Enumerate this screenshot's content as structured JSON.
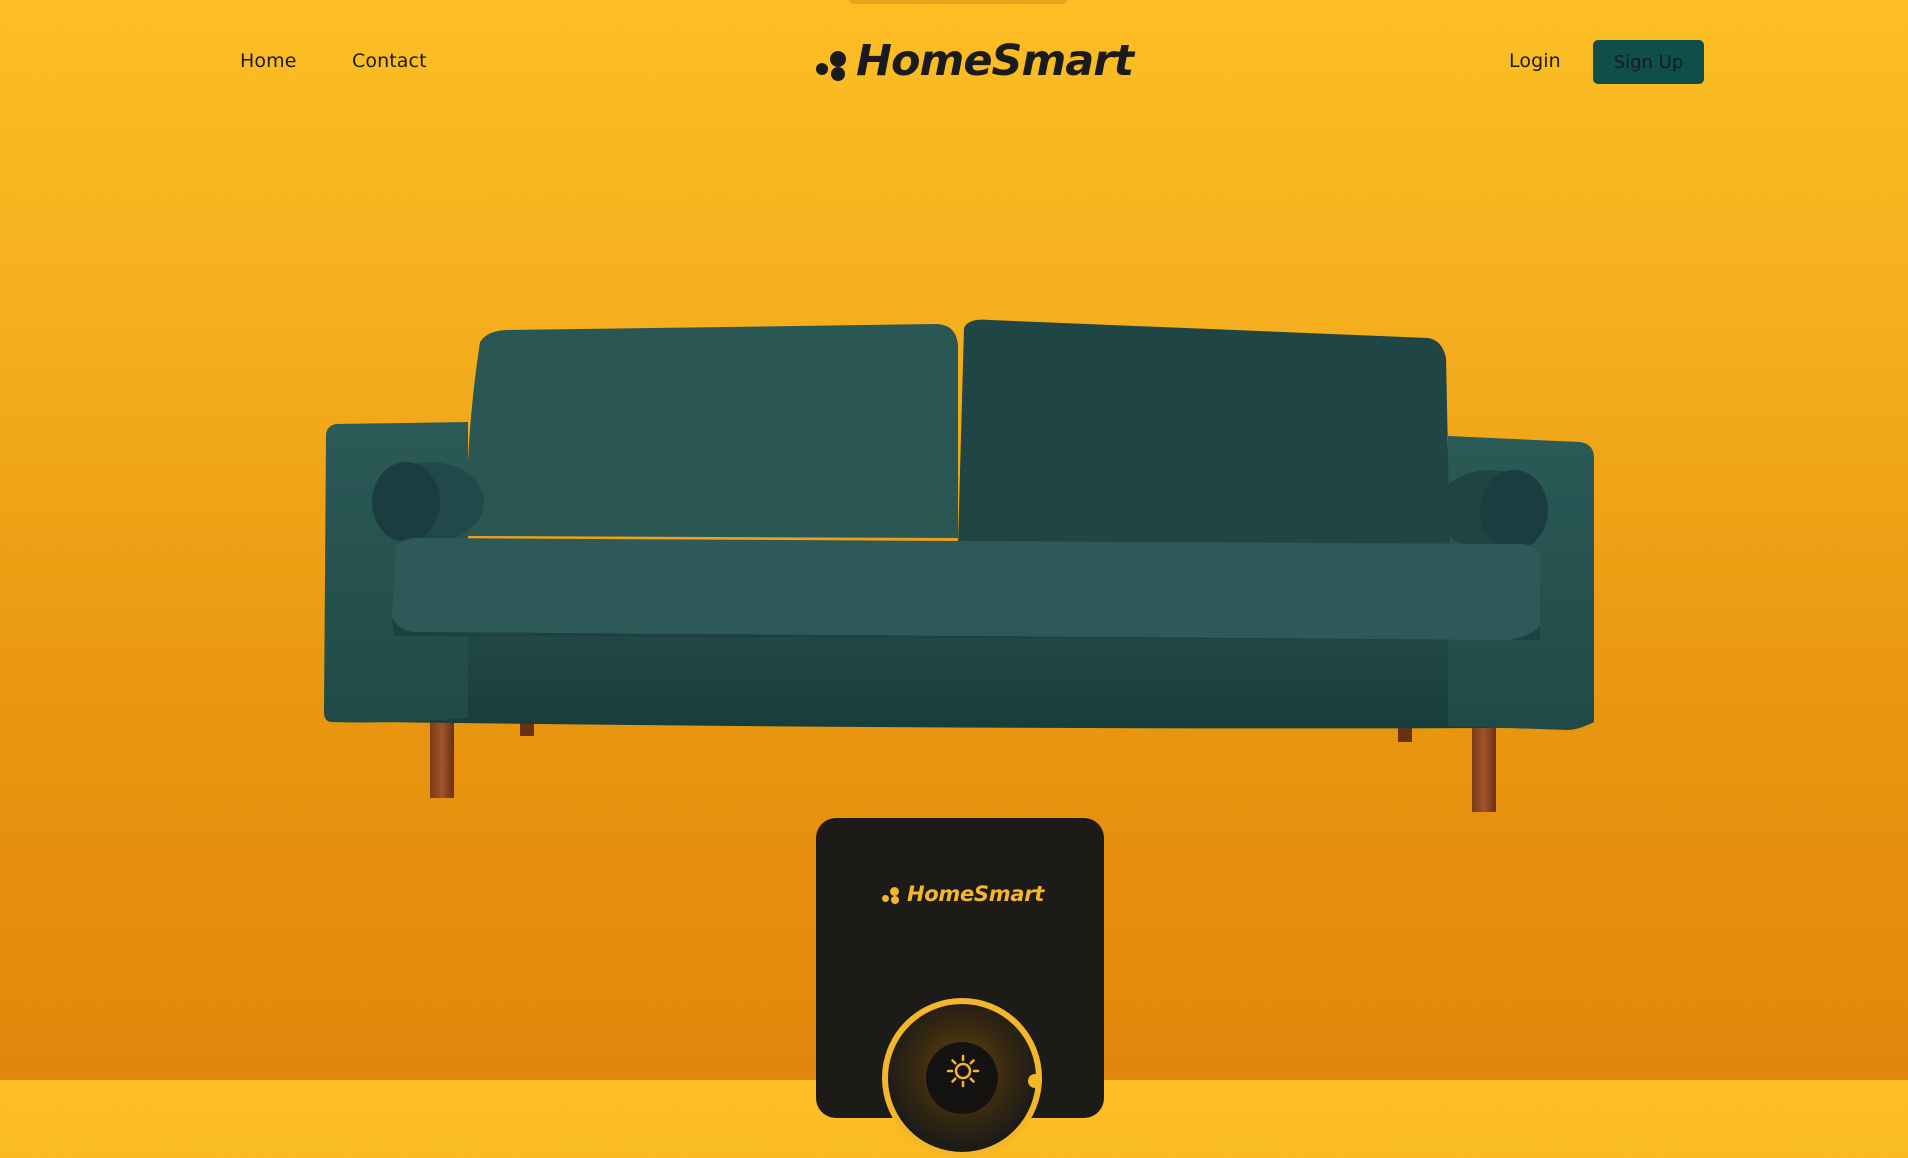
{
  "nav": {
    "home": "Home",
    "contact": "Contact",
    "login": "Login",
    "signup": "Sign Up"
  },
  "brand": {
    "name": "HomeSmart",
    "icon": "dots-logo-icon"
  },
  "hero": {
    "image": "green-velvet-sofa"
  },
  "device": {
    "brand": "HomeSmart",
    "dial_icon": "sun-icon"
  },
  "colors": {
    "accent": "#fcbf24",
    "brand_teal": "#0f4f4a",
    "device_bg": "#1d1b18",
    "device_accent": "#f5b62a"
  }
}
